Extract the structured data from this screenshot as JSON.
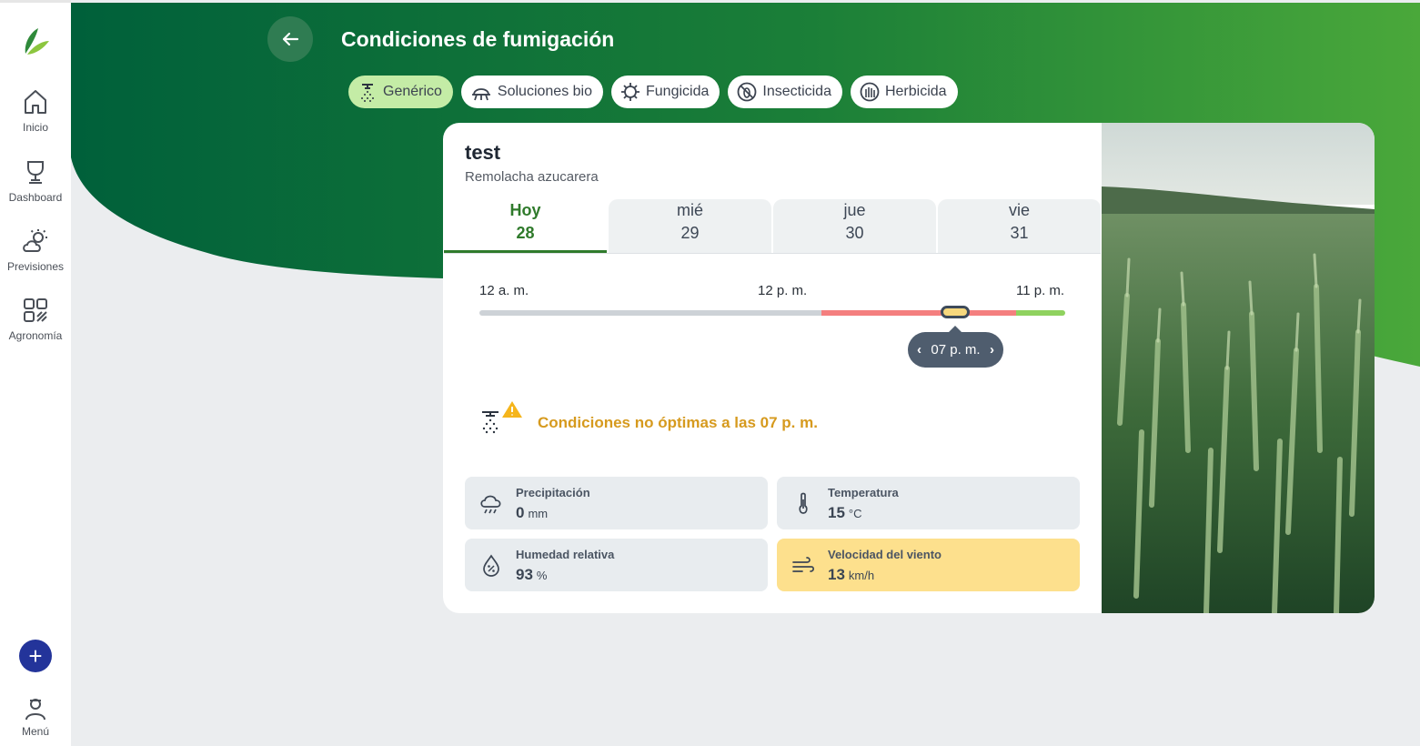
{
  "sidebar": {
    "items": [
      {
        "label": "Inicio",
        "icon": "home-icon"
      },
      {
        "label": "Dashboard",
        "icon": "dashboard-icon"
      },
      {
        "label": "Previsiones",
        "icon": "weather-icon"
      },
      {
        "label": "Agronomía",
        "icon": "agronomy-icon"
      }
    ],
    "add_symbol": "+",
    "menu_label": "Menú"
  },
  "header": {
    "title": "Condiciones de fumigación",
    "chips": [
      {
        "label": "Genérico",
        "icon": "sprayer-icon",
        "active": true
      },
      {
        "label": "Soluciones bio",
        "icon": "bio-icon",
        "active": false
      },
      {
        "label": "Fungicida",
        "icon": "fungicide-icon",
        "active": false
      },
      {
        "label": "Insecticida",
        "icon": "insecticide-icon",
        "active": false
      },
      {
        "label": "Herbicida",
        "icon": "herbicide-icon",
        "active": false
      }
    ]
  },
  "field": {
    "name": "test",
    "crop": "Remolacha azucarera"
  },
  "days": [
    {
      "name": "Hoy",
      "num": "28",
      "active": true
    },
    {
      "name": "mié",
      "num": "29",
      "active": false
    },
    {
      "name": "jue",
      "num": "30",
      "active": false
    },
    {
      "name": "vie",
      "num": "31",
      "active": false
    }
  ],
  "timeline": {
    "start_label": "12 a. m.",
    "mid_label": "12 p. m.",
    "end_label": "11 p. m.",
    "selected_time": "07 p. m.",
    "selected_hour": 19,
    "segments": [
      {
        "from_hour": 0,
        "to_hour": 14,
        "status": "unavailable",
        "color": "#cdd2d7"
      },
      {
        "from_hour": 14,
        "to_hour": 22,
        "status": "not-optimal",
        "color": "#f47f7f"
      },
      {
        "from_hour": 22,
        "to_hour": 24,
        "status": "optimal",
        "color": "#8fd25f"
      }
    ]
  },
  "warning": {
    "text": "Condiciones no óptimas a las 07 p. m.",
    "color": "#d69a1e"
  },
  "metrics": [
    {
      "label": "Precipitación",
      "value": "0",
      "unit": "mm",
      "icon": "rain-icon",
      "alert": false
    },
    {
      "label": "Temperatura",
      "value": "15",
      "unit": "°C",
      "icon": "thermometer-icon",
      "alert": false
    },
    {
      "label": "Humedad relativa",
      "value": "93",
      "unit": "%",
      "icon": "humidity-icon",
      "alert": false
    },
    {
      "label": "Velocidad del viento",
      "value": "13",
      "unit": "km/h",
      "icon": "wind-icon",
      "alert": true
    }
  ],
  "colors": {
    "brand_green": "#006b3a",
    "accent_green": "#2f7a2b",
    "alert_yellow": "#fde08d"
  }
}
